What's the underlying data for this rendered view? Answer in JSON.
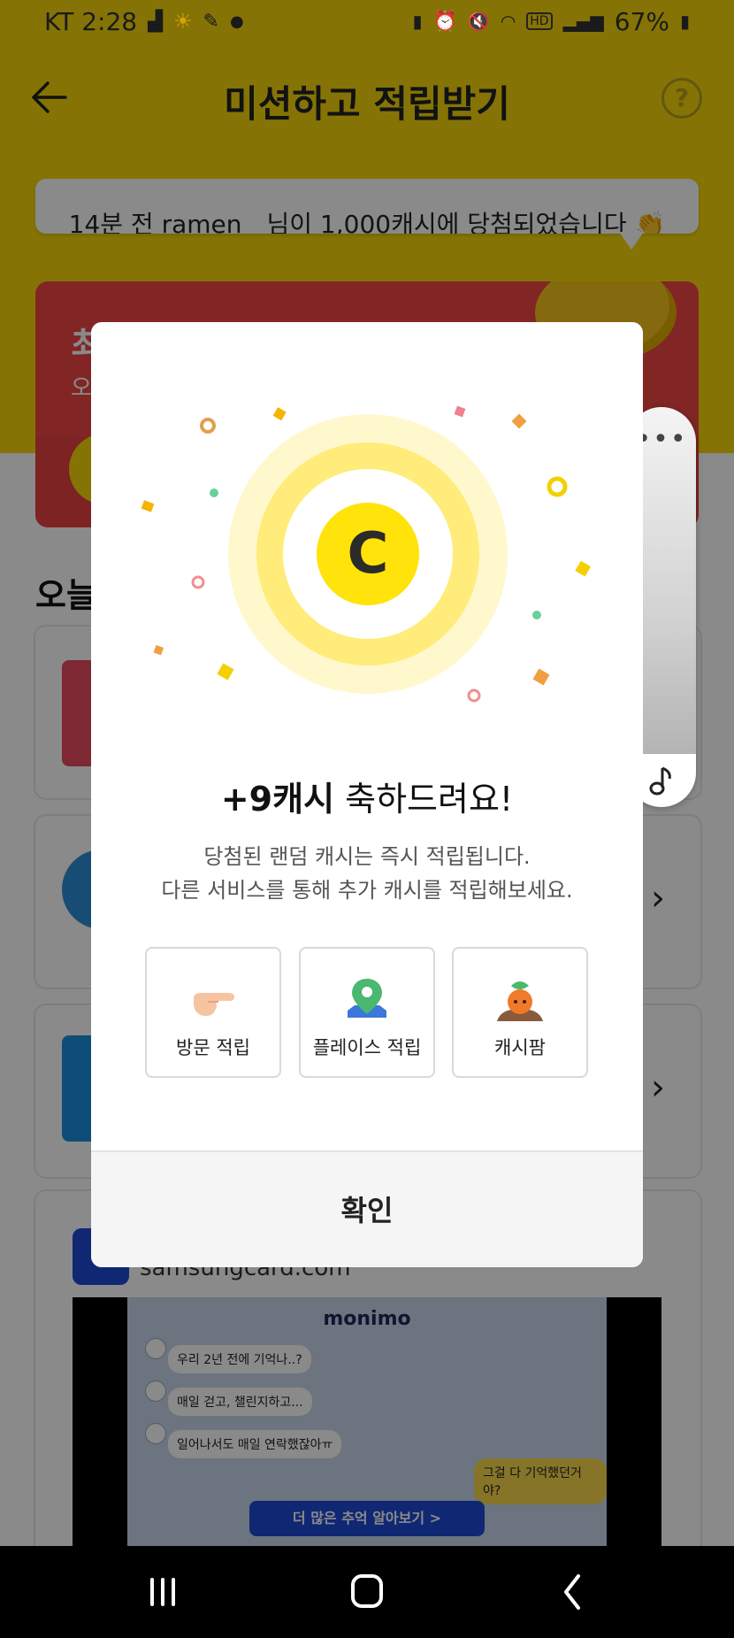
{
  "status_bar": {
    "carrier_time": "KT 2:28",
    "battery": "67%",
    "icons": [
      "notification-icon",
      "sun-icon",
      "pen-icon",
      "dot-icon",
      "battery-saver-icon",
      "alarm-icon",
      "mute-icon",
      "wifi-icon",
      "hd-icon",
      "signal-icon",
      "battery-icon"
    ]
  },
  "header": {
    "title": "미션하고 적립받기",
    "ticker_text": "14분 전 ramen__님이 1,000캐시에 당첨되었습니다 👏"
  },
  "promo": {
    "title": "최",
    "subtitle": "오"
  },
  "section": {
    "title": "오늘"
  },
  "ad": {
    "domain": "samsungcard.com",
    "brand": "monimo",
    "chats": [
      "우리 2년 전에 기억나..?",
      "매일 걷고, 챌린지하고...",
      "일어나서도 매일 연락했잖아ㅠ"
    ],
    "reply": "그걸 다 기억했던거야?",
    "cta": "더 많은 추억 알아보기 >"
  },
  "dialog": {
    "amount": "+9캐시",
    "title_suffix": " 축하드려요!",
    "desc_line1": "당첨된 랜덤 캐시는 즉시 적립됩니다.",
    "desc_line2": "다른 서비스를 통해 추가 캐시를 적립해보세요.",
    "coin_letter": "C",
    "services": [
      {
        "label": "방문 적립",
        "icon": "pointing-hand-icon"
      },
      {
        "label": "플레이스 적립",
        "icon": "map-pin-icon"
      },
      {
        "label": "캐시팜",
        "icon": "carrot-icon"
      }
    ],
    "confirm_label": "확인"
  },
  "float_widget": {
    "dots": "•••"
  },
  "colors": {
    "brand_yellow": "#f5d70a",
    "coin_yellow": "#ffe30a",
    "promo_red": "#f04545",
    "ad_blue": "#1f49d6"
  }
}
